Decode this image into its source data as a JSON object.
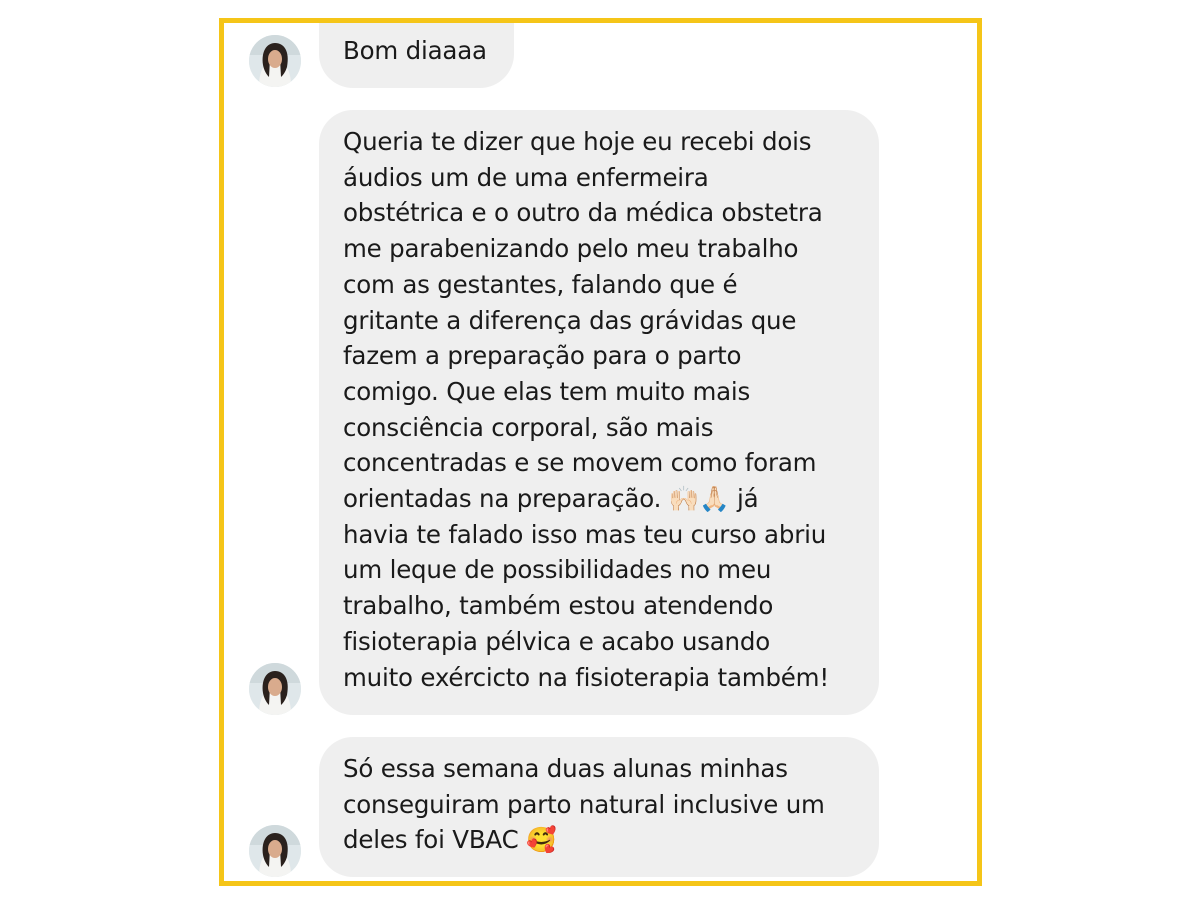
{
  "messages": [
    {
      "lines": [
        "Bom diaaaa"
      ]
    },
    {
      "lines": [
        "Queria te dizer que hoje eu recebi dois",
        "áudios um de uma enfermeira",
        "obstétrica e o outro da médica obstetra",
        "me parabenizando pelo meu trabalho",
        "com as gestantes, falando que é",
        "gritante a diferença das grávidas que",
        "fazem a preparação para o parto",
        "comigo. Que elas tem muito mais",
        "consciência corporal, são mais",
        "concentradas e se movem como foram",
        "orientadas na preparação. 🙌🏻🙏🏻 já",
        "havia te falado isso mas teu curso abriu",
        "um leque de possibilidades no meu",
        "trabalho, também estou atendendo",
        "fisioterapia pélvica e acabo usando",
        "muito exércicto na fisioterapia também!"
      ]
    },
    {
      "lines": [
        "Só essa semana duas alunas minhas",
        "conseguiram parto natural inclusive um",
        "deles foi VBAC 🥰"
      ]
    }
  ],
  "colors": {
    "frame_border": "#f5c518",
    "bubble_background": "#efefef",
    "text": "#1a1a1a"
  },
  "icons": [
    "sender-avatar"
  ]
}
